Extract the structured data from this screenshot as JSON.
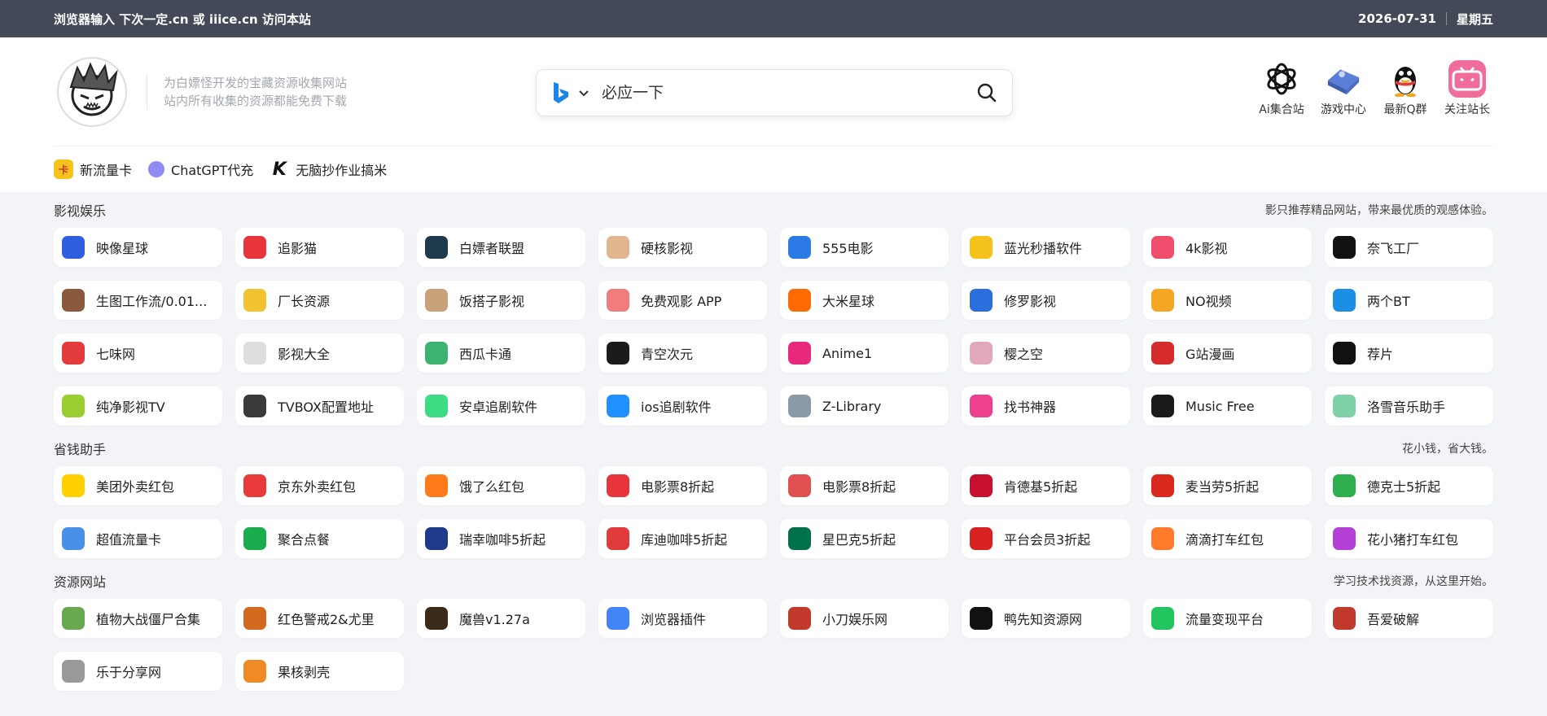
{
  "topbar": {
    "notice": "浏览器输入 下次一定.cn 或 iiice.cn 访问本站",
    "date": "2026-07-31",
    "weekday": "星期五"
  },
  "header": {
    "tagline_1": "为白嫖怪开发的宝藏资源收集网站",
    "tagline_2": "站内所有收集的资源都能免费下载",
    "search_placeholder": "必应一下",
    "search_engine_icon": "bing-icon",
    "quick_links": [
      {
        "label": "Ai集合站",
        "icon": "openai-icon",
        "color": "#ffffff"
      },
      {
        "label": "游戏中心",
        "icon": "gamepad-icon",
        "color": "#5b7fd6"
      },
      {
        "label": "最新Q群",
        "icon": "qq-penguin-icon",
        "color": "#ffffff"
      },
      {
        "label": "关注站长",
        "icon": "bilibili-icon",
        "color": "#f06c9a"
      }
    ]
  },
  "promo": [
    {
      "label": "新流量卡",
      "icon": "sim-card-icon",
      "color": "#f6c21c"
    },
    {
      "label": "ChatGPT代充",
      "icon": "chatgpt-icon",
      "color": "#8e8cf2"
    },
    {
      "label": "无脑抄作业搞米",
      "icon": "k-logo-icon",
      "color": "#111111"
    }
  ],
  "sections": [
    {
      "title": "影视娱乐",
      "desc": "影只推荐精品网站，带来最优质的观感体验。",
      "items": [
        {
          "label": "映像星球",
          "color": "#2f5fe0"
        },
        {
          "label": "追影猫",
          "color": "#e8343b"
        },
        {
          "label": "白嫖者联盟",
          "color": "#1e3a4c"
        },
        {
          "label": "硬核影视",
          "color": "#e0b590"
        },
        {
          "label": "555电影",
          "color": "#2c7be5"
        },
        {
          "label": "蓝光秒播软件",
          "color": "#f4c21a"
        },
        {
          "label": "4k影视",
          "color": "#f0506e"
        },
        {
          "label": "奈飞工厂",
          "color": "#111111"
        },
        {
          "label": "生图工作流/0.01...",
          "color": "#8a5a3c"
        },
        {
          "label": "厂长资源",
          "color": "#f2c230"
        },
        {
          "label": "饭搭子影视",
          "color": "#c9a27a"
        },
        {
          "label": "免费观影 APP",
          "color": "#f07c7c"
        },
        {
          "label": "大米星球",
          "color": "#ff6a00"
        },
        {
          "label": "修罗影视",
          "color": "#2a6fdb"
        },
        {
          "label": "NO视频",
          "color": "#f5a623"
        },
        {
          "label": "两个BT",
          "color": "#1a8fe3"
        },
        {
          "label": "七味网",
          "color": "#e33b3b"
        },
        {
          "label": "影视大全",
          "color": "#dddddd"
        },
        {
          "label": "西瓜卡通",
          "color": "#3cb371"
        },
        {
          "label": "青空次元",
          "color": "#1b1b1b"
        },
        {
          "label": "Anime1",
          "color": "#e8287a"
        },
        {
          "label": "樱之空",
          "color": "#e0a8b8"
        },
        {
          "label": "G站漫画",
          "color": "#d62b2b"
        },
        {
          "label": "荐片",
          "color": "#111111"
        },
        {
          "label": "纯净影视TV",
          "color": "#9acd32"
        },
        {
          "label": "TVBOX配置地址",
          "color": "#3a3a3a"
        },
        {
          "label": "安卓追剧软件",
          "color": "#3ddc84"
        },
        {
          "label": "ios追剧软件",
          "color": "#1e90ff"
        },
        {
          "label": "Z-Library",
          "color": "#8a9aa8"
        },
        {
          "label": "找书神器",
          "color": "#ef3f8f"
        },
        {
          "label": "Music Free",
          "color": "#1b1b1b"
        },
        {
          "label": "洛雪音乐助手",
          "color": "#7fd1a8"
        }
      ]
    },
    {
      "title": "省钱助手",
      "desc": "花小钱，省大钱。",
      "items": [
        {
          "label": "美团外卖红包",
          "color": "#ffd100"
        },
        {
          "label": "京东外卖红包",
          "color": "#e83a3a"
        },
        {
          "label": "饿了么红包",
          "color": "#ff7a1a"
        },
        {
          "label": "电影票8折起",
          "color": "#e8343b"
        },
        {
          "label": "电影票8折起",
          "color": "#e05050"
        },
        {
          "label": "肯德基5折起",
          "color": "#c8102e"
        },
        {
          "label": "麦当劳5折起",
          "color": "#da291c"
        },
        {
          "label": "德克士5折起",
          "color": "#2eae4f"
        },
        {
          "label": "超值流量卡",
          "color": "#4a8fe8"
        },
        {
          "label": "聚合点餐",
          "color": "#1aad4e"
        },
        {
          "label": "瑞幸咖啡5折起",
          "color": "#1e3a8a"
        },
        {
          "label": "库迪咖啡5折起",
          "color": "#e03a3a"
        },
        {
          "label": "星巴克5折起",
          "color": "#00704a"
        },
        {
          "label": "平台会员3折起",
          "color": "#d92121"
        },
        {
          "label": "滴滴打车红包",
          "color": "#ff7a2a"
        },
        {
          "label": "花小猪打车红包",
          "color": "#b540d8"
        }
      ]
    },
    {
      "title": "资源网站",
      "desc": "学习技术找资源，从这里开始。",
      "items": [
        {
          "label": "植物大战僵尸合集",
          "color": "#6aa84f"
        },
        {
          "label": "红色警戒2&尤里",
          "color": "#d2691e"
        },
        {
          "label": "魔兽v1.27a",
          "color": "#3b2a1a"
        },
        {
          "label": "浏览器插件",
          "color": "#4285f4"
        },
        {
          "label": "小刀娱乐网",
          "color": "#c0392b"
        },
        {
          "label": "鸭先知资源网",
          "color": "#111111"
        },
        {
          "label": "流量变现平台",
          "color": "#22c55e"
        },
        {
          "label": "吾爱破解",
          "color": "#c0392b"
        },
        {
          "label": "乐于分享网",
          "color": "#999999"
        },
        {
          "label": "果核剥壳",
          "color": "#f08a24"
        }
      ]
    }
  ]
}
